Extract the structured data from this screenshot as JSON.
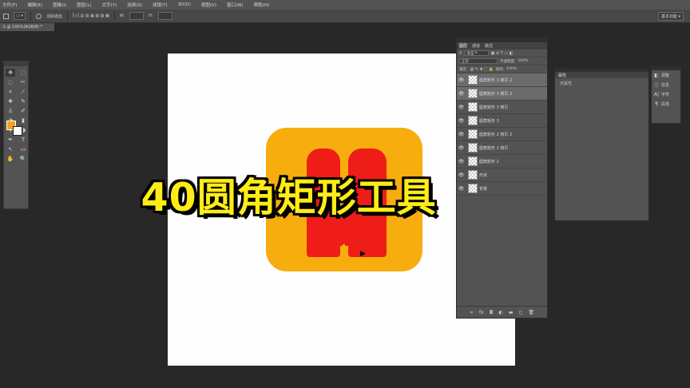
{
  "menu": [
    "文件(F)",
    "编辑(E)",
    "图像(I)",
    "图层(L)",
    "文字(Y)",
    "选择(S)",
    "滤镜(T)",
    "3D(D)",
    "视图(V)",
    "窗口(W)",
    "帮助(H)"
  ],
  "options": {
    "aa_label": "消除锯齿",
    "width_label": "W:",
    "height_label": "H:",
    "workspace": "基本功能"
  },
  "doc_tab": "-1.@ 100%(RGB/8) *",
  "tools": [
    "✥",
    "⬚",
    "◌",
    "✂",
    "⌗",
    "⁄",
    "✚",
    "✎",
    "♙",
    "✐",
    "◔",
    "▮",
    "⚲",
    "◑",
    "✒",
    "T",
    "↖",
    "▭",
    "✋",
    "🔍"
  ],
  "title": "40圆角矩形工具（U）",
  "layers_panel": {
    "tabs": [
      "图层",
      "通道",
      "路径"
    ],
    "kind": "类型",
    "blend": "正常",
    "opacity_label": "不透明度:",
    "opacity": "100%",
    "lock_label": "锁定:",
    "fill_label": "填充:",
    "fill": "100%",
    "layers": [
      {
        "name": "圆角矩形 3 拷贝 2",
        "selected": true
      },
      {
        "name": "圆角矩形 3 拷贝 2",
        "selected": true
      },
      {
        "name": "圆角矩形 3 拷贝",
        "selected": false
      },
      {
        "name": "圆角矩形 3",
        "selected": false
      },
      {
        "name": "圆角矩形 2 拷贝 2",
        "selected": false
      },
      {
        "name": "圆角矩形 2 拷贝",
        "selected": false
      },
      {
        "name": "圆角矩形 2",
        "selected": false
      },
      {
        "name": "形状",
        "selected": false
      },
      {
        "name": "背景",
        "selected": false
      }
    ],
    "footer_icons": [
      "∞",
      "fx",
      "◘",
      "◐",
      "▬",
      "◻",
      "🗑"
    ]
  },
  "properties_panel": {
    "tab": "属性",
    "sub": "无属性"
  },
  "dock": [
    {
      "icon": "◧",
      "label": "调整"
    },
    {
      "icon": "ⓘ",
      "label": "信息"
    },
    {
      "icon": "A|",
      "label": "字符"
    },
    {
      "icon": "¶",
      "label": "段落"
    }
  ],
  "colors": {
    "foreground": "#f7a11a",
    "background": "#ffffff",
    "icon_orange": "#f8ad0f",
    "icon_red": "#ee1d18",
    "title_yellow": "#ffec16"
  }
}
